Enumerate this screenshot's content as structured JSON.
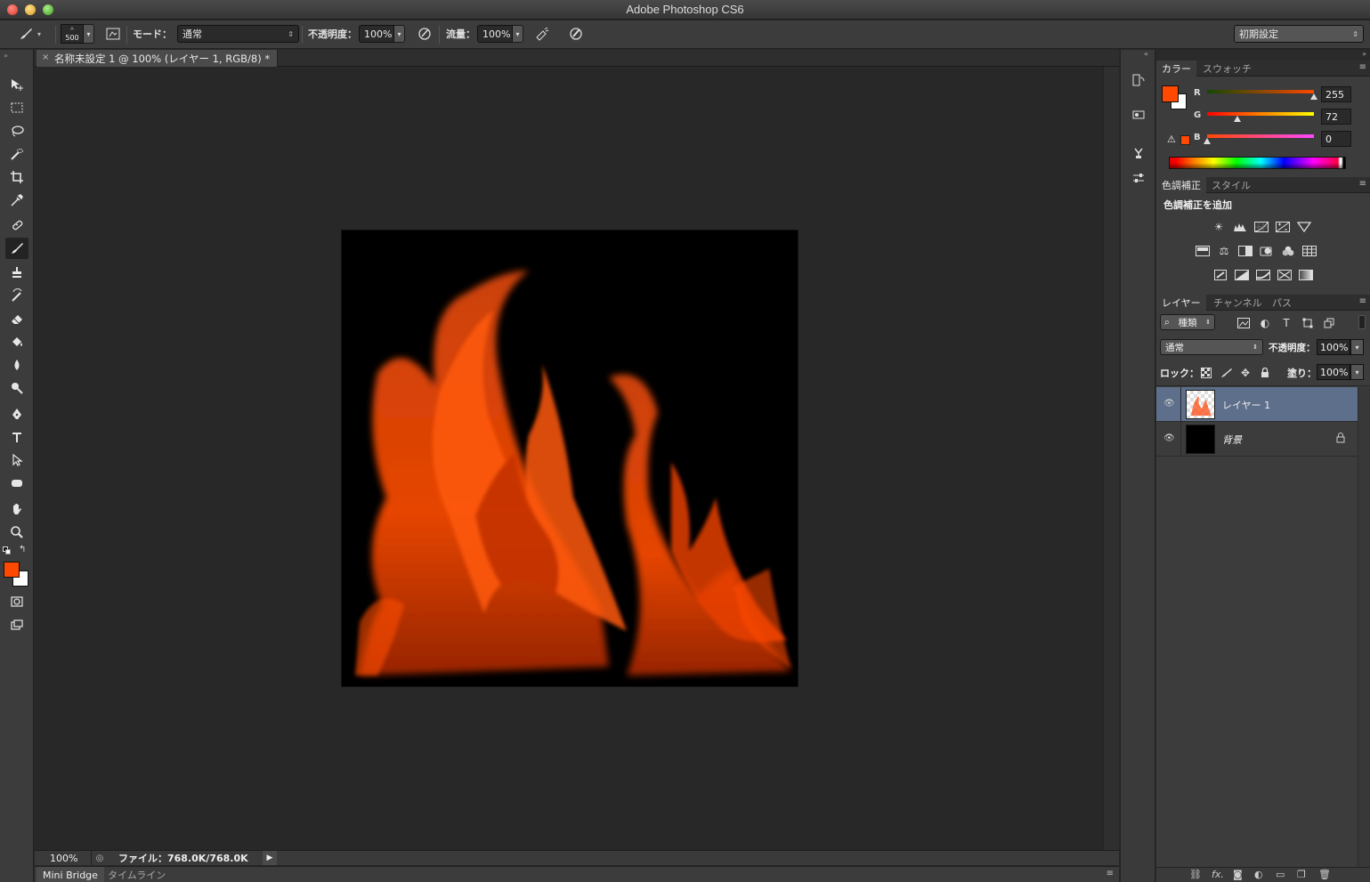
{
  "window": {
    "title": "Adobe Photoshop CS6"
  },
  "options_bar": {
    "brush_size": "500",
    "mode_label": "モード：",
    "mode_value": "通常",
    "opacity_label": "不透明度：",
    "opacity_value": "100%",
    "flow_label": "流量：",
    "flow_value": "100%",
    "workspace_value": "初期設定"
  },
  "document": {
    "tab_title": "名称未設定 1 @ 100% (レイヤー 1, RGB/8) *",
    "tab_close": "×"
  },
  "status_bar": {
    "zoom": "100%",
    "file_info": "ファイル：768.0K/768.0K"
  },
  "bottom_tabs": [
    "Mini Bridge",
    "タイムライン"
  ],
  "color_panel": {
    "tabs": [
      "カラー",
      "スウォッチ"
    ],
    "foreground": "#ff4800",
    "background": "#ffffff",
    "r_label": "R",
    "r_value": "255",
    "g_label": "G",
    "g_value": "72",
    "b_label": "B",
    "b_value": "0"
  },
  "adjustments_panel": {
    "tabs": [
      "色調補正",
      "スタイル"
    ],
    "heading": "色調補正を追加"
  },
  "layers_panel": {
    "tabs": [
      "レイヤー",
      "チャンネル",
      "パス"
    ],
    "filter_value": "種類",
    "blend_value": "通常",
    "opacity_label": "不透明度：",
    "opacity_value": "100%",
    "lock_label": "ロック：",
    "fill_label": "塗り：",
    "fill_value": "100%",
    "layers": [
      {
        "name": "レイヤー 1",
        "selected": true
      },
      {
        "name": "背景",
        "selected": false
      }
    ]
  },
  "colors": {
    "accent_orange": "#ff4800",
    "selected_layer": "#5d6f8a"
  }
}
